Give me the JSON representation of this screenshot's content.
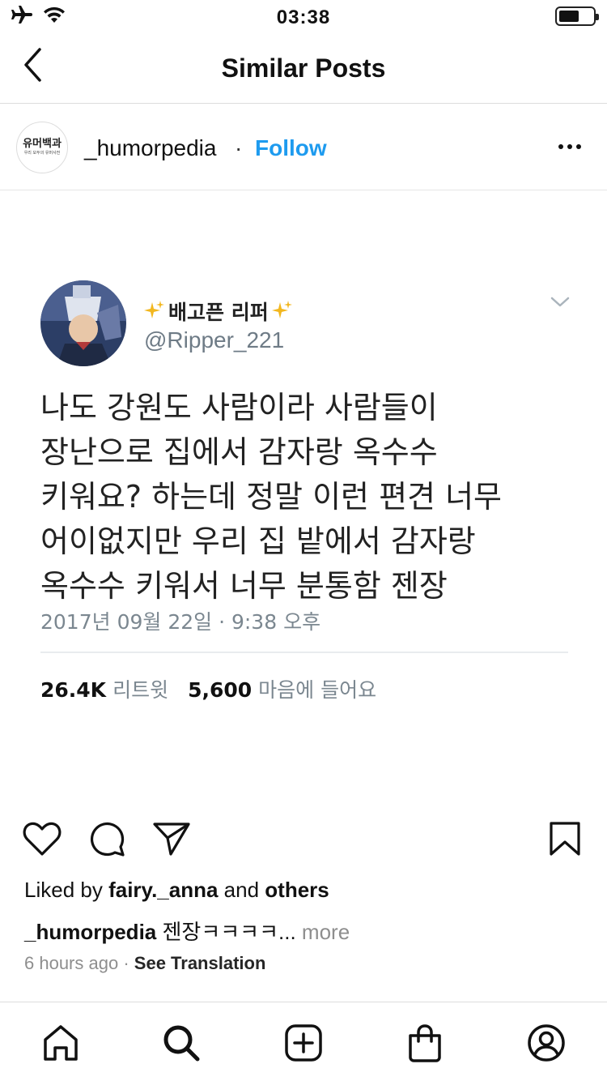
{
  "status_bar": {
    "time": "03:38"
  },
  "nav": {
    "title": "Similar Posts"
  },
  "post": {
    "avatar_text_main": "유머백과",
    "avatar_text_sub": "우리 모두의 유머사전",
    "username": "_humorpedia",
    "separator": "·",
    "follow_label": "Follow",
    "tweet": {
      "name": "배고픈 리퍼",
      "handle": "@Ripper_221",
      "text": "나도 강원도 사람이라 사람들이\n장난으로 집에서 감자랑 옥수수\n키워요? 하는데 정말 이런 편견 너무\n어이없지만 우리 집 밭에서 감자랑\n옥수수 키워서 너무 분통함 젠장",
      "date": "2017년 09월 22일 · 9:38 오후",
      "retweets_count": "26.4K",
      "retweets_label": "리트윗",
      "likes_count": "5,600",
      "likes_label": "마음에 들어요"
    },
    "liked_by_prefix": "Liked by",
    "liked_by_user": "fairy._anna",
    "liked_by_and": "and",
    "liked_by_others": "others",
    "caption_user": "_humorpedia",
    "caption_text": "젠장ㅋㅋㅋㅋ...",
    "caption_more": "more",
    "time_ago": "6 hours ago",
    "meta_separator": "·",
    "see_translation": "See Translation"
  },
  "icons": {
    "status": [
      "airplane-icon",
      "wifi-icon",
      "battery-icon"
    ],
    "actions": [
      "heart-icon",
      "comment-icon",
      "share-icon",
      "bookmark-icon"
    ],
    "tabs": [
      "home-icon",
      "search-icon",
      "add-post-icon",
      "shop-icon",
      "profile-icon"
    ]
  },
  "colors": {
    "follow": "#1e9bef",
    "secondary_text": "#8e8e8e",
    "tweet_gray": "#7b8790"
  }
}
